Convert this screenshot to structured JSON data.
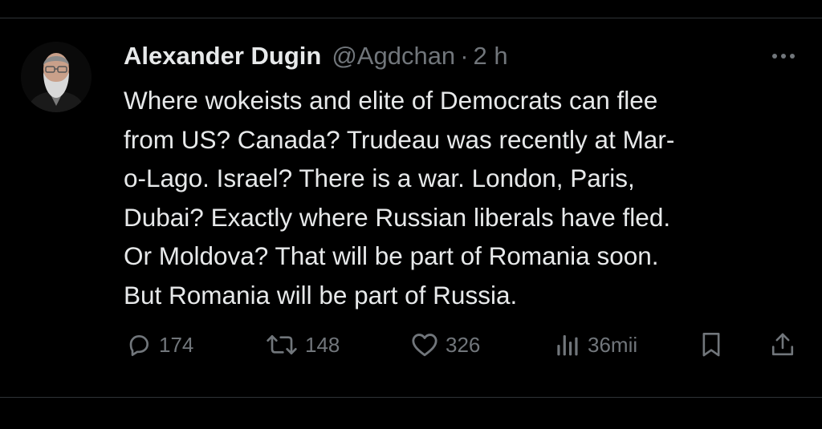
{
  "tweet": {
    "author": {
      "display_name": "Alexander Dugin",
      "handle": "@Agdchan",
      "separator": "·",
      "time": "2 h"
    },
    "text_lines": [
      "Where wokeists and elite of Democrats can flee",
      "from US? Canada? Trudeau was recently at Mar-",
      "o-Lago. Israel? There is a war. London, Paris,",
      "Dubai? Exactly where Russian liberals have fled.",
      "Or Moldova? That will be part of Romania soon.",
      "But Romania will be part of Russia."
    ],
    "actions": {
      "replies": "174",
      "reposts": "148",
      "likes": "326",
      "views": "36mii"
    }
  },
  "icons": {
    "more": "more-horizontal-icon",
    "reply": "reply-bubble-icon",
    "repost": "repost-arrows-icon",
    "like": "heart-icon",
    "views": "bar-chart-icon",
    "bookmark": "bookmark-icon",
    "share": "share-upload-icon"
  },
  "colors": {
    "background": "#000000",
    "text_primary": "#e7e9ea",
    "text_secondary": "#71767b",
    "divider": "#2f3336"
  }
}
